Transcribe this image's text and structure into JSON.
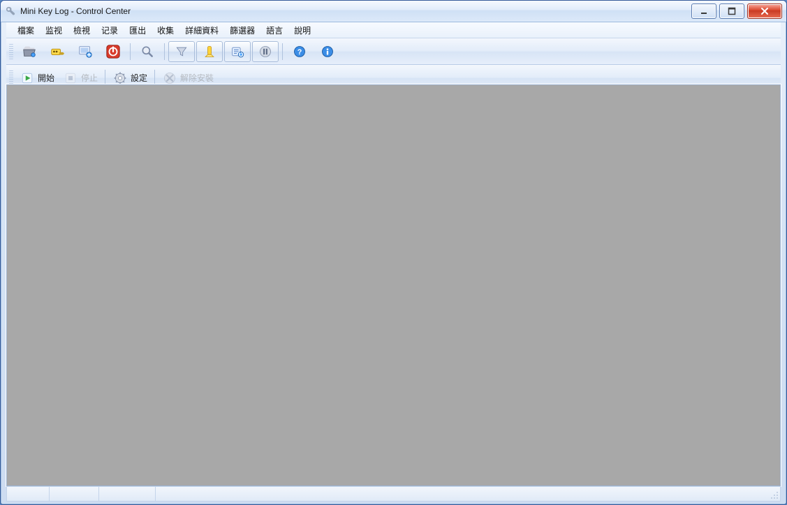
{
  "window": {
    "title": "Mini Key Log - Control Center"
  },
  "menu": {
    "items": [
      "檔案",
      "监视",
      "檢視",
      "记录",
      "匯出",
      "收集",
      "詳細資料",
      "篩選器",
      "語言",
      "說明"
    ]
  },
  "toolbar1": {
    "icons": [
      {
        "name": "open-log-icon"
      },
      {
        "name": "key-credentials-icon"
      },
      {
        "name": "screenshot-settings-icon"
      },
      {
        "name": "power-icon"
      }
    ],
    "icons_group2": [
      {
        "name": "search-icon"
      }
    ],
    "icons_group3": [
      {
        "name": "filter-icon"
      },
      {
        "name": "highlight-icon"
      },
      {
        "name": "refresh-data-icon"
      },
      {
        "name": "pause-icon"
      }
    ],
    "icons_group4": [
      {
        "name": "help-icon"
      },
      {
        "name": "info-icon"
      }
    ]
  },
  "toolbar2": {
    "start_label": "開始",
    "stop_label": "停止",
    "settings_label": "設定",
    "uninstall_label": "解除安裝"
  },
  "colors": {
    "accent": "#2e66b2",
    "close_red": "#d9432a",
    "content_bg": "#a8a8a8"
  }
}
